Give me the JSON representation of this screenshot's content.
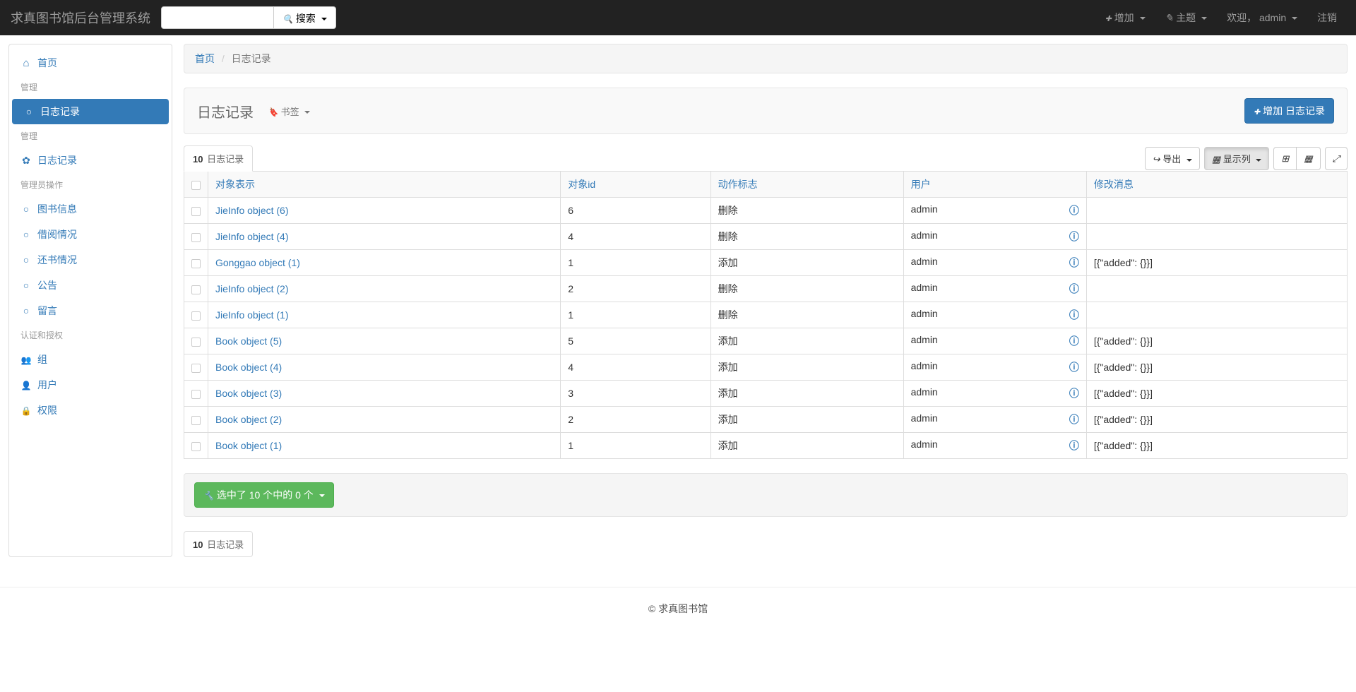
{
  "brand": "求真图书馆后台管理系统",
  "search": {
    "placeholder": "",
    "btn": "搜索"
  },
  "nav": {
    "add": "增加",
    "theme": "主题",
    "welcome": "欢迎，",
    "user": "admin",
    "logout": "注销"
  },
  "sidebar": {
    "home": "首页",
    "h1": "管理",
    "log1": "日志记录",
    "h2": "管理",
    "log2": "日志记录",
    "h3": "管理员操作",
    "books": "图书信息",
    "borrow": "借阅情况",
    "return": "还书情况",
    "notice": "公告",
    "guestbook": "留言",
    "h4": "认证和授权",
    "groups": "组",
    "users": "用户",
    "perms": "权限"
  },
  "breadcrumb": {
    "home": "首页",
    "current": "日志记录"
  },
  "panel": {
    "title": "日志记录",
    "bookmark": "书签",
    "add": "增加 日志记录"
  },
  "toolbar": {
    "count": "10",
    "count_label": "日志记录",
    "export": "导出",
    "columns": "显示列"
  },
  "table": {
    "headers": {
      "repr": "对象表示",
      "id": "对象id",
      "flag": "动作标志",
      "user": "用户",
      "msg": "修改消息"
    },
    "rows": [
      {
        "repr": "JieInfo object (6)",
        "id": "6",
        "flag": "删除",
        "user": "admin",
        "msg": ""
      },
      {
        "repr": "JieInfo object (4)",
        "id": "4",
        "flag": "删除",
        "user": "admin",
        "msg": ""
      },
      {
        "repr": "Gonggao object (1)",
        "id": "1",
        "flag": "添加",
        "user": "admin",
        "msg": "[{\"added\": {}}]"
      },
      {
        "repr": "JieInfo object (2)",
        "id": "2",
        "flag": "删除",
        "user": "admin",
        "msg": ""
      },
      {
        "repr": "JieInfo object (1)",
        "id": "1",
        "flag": "删除",
        "user": "admin",
        "msg": ""
      },
      {
        "repr": "Book object (5)",
        "id": "5",
        "flag": "添加",
        "user": "admin",
        "msg": "[{\"added\": {}}]"
      },
      {
        "repr": "Book object (4)",
        "id": "4",
        "flag": "添加",
        "user": "admin",
        "msg": "[{\"added\": {}}]"
      },
      {
        "repr": "Book object (3)",
        "id": "3",
        "flag": "添加",
        "user": "admin",
        "msg": "[{\"added\": {}}]"
      },
      {
        "repr": "Book object (2)",
        "id": "2",
        "flag": "添加",
        "user": "admin",
        "msg": "[{\"added\": {}}]"
      },
      {
        "repr": "Book object (1)",
        "id": "1",
        "flag": "添加",
        "user": "admin",
        "msg": "[{\"added\": {}}]"
      }
    ]
  },
  "actions": {
    "selected": "选中了 10 个中的 0 个"
  },
  "footer": "© 求真图书馆"
}
